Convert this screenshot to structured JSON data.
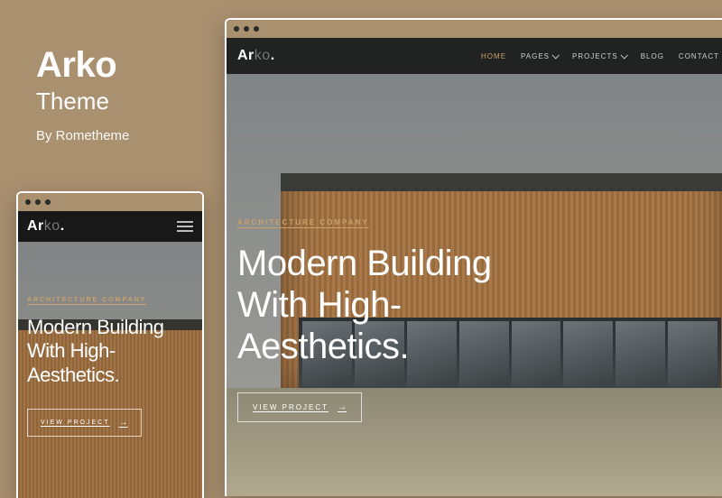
{
  "info": {
    "title": "Arko",
    "subtitle": "Theme",
    "author": "By Rometheme"
  },
  "logo": {
    "part1": "Ar",
    "part2": "ko",
    "dot": "."
  },
  "nav": {
    "home": "HOME",
    "pages": "PAGES",
    "projects": "PROJECTS",
    "blog": "BLOG",
    "contact": "CONTACT"
  },
  "hero": {
    "eyebrow": "ARCHITECTURE COMPANY",
    "headline": "Modern Building With High-Aesthetics.",
    "cta": "VIEW PROJECT",
    "arrow": "→"
  }
}
